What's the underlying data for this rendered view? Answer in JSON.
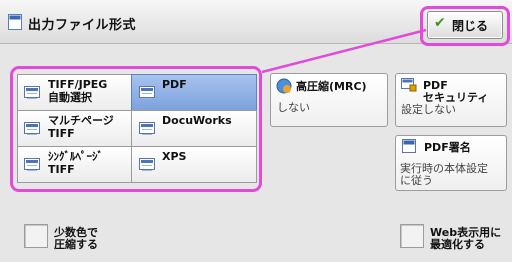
{
  "header": {
    "title": "出力ファイル形式",
    "close_label": "閉じる"
  },
  "formats": [
    {
      "line1": "TIFF/JPEG",
      "line2": "自動選択",
      "icon": "tiff-jpeg-icon",
      "selected": false
    },
    {
      "line1": "PDF",
      "line2": "",
      "icon": "pdf-icon",
      "selected": true
    },
    {
      "line1": "マルチページ",
      "line2": "TIFF",
      "icon": "multipage-tiff-icon",
      "selected": false
    },
    {
      "line1": "DocuWorks",
      "line2": "",
      "icon": "docuworks-icon",
      "selected": false
    },
    {
      "line1": "ｼﾝｸﾞﾙﾍﾟｰｼﾞ",
      "line2": "TIFF",
      "icon": "single-page-tiff-icon",
      "selected": false
    },
    {
      "line1": "XPS",
      "line2": "",
      "icon": "xps-icon",
      "selected": false
    }
  ],
  "options": {
    "compression": {
      "title": "高圧縮(MRC)",
      "value": "しない"
    },
    "pdf_security": {
      "title_line1": "PDF",
      "title_line2": "セキュリティ",
      "value": "設定しない"
    },
    "pdf_signature": {
      "title": "PDF署名",
      "value_line1": "実行時の本体設定",
      "value_line2": "に従う"
    }
  },
  "checkboxes": {
    "reduce_colors": {
      "line1": "少数色で",
      "line2": "圧縮する",
      "checked": false
    },
    "web_optimize": {
      "line1": "Web表示用に",
      "line2": "最適化する",
      "checked": false
    }
  },
  "colors": {
    "highlight": "#e04bd8",
    "selected": "#7da2de"
  }
}
